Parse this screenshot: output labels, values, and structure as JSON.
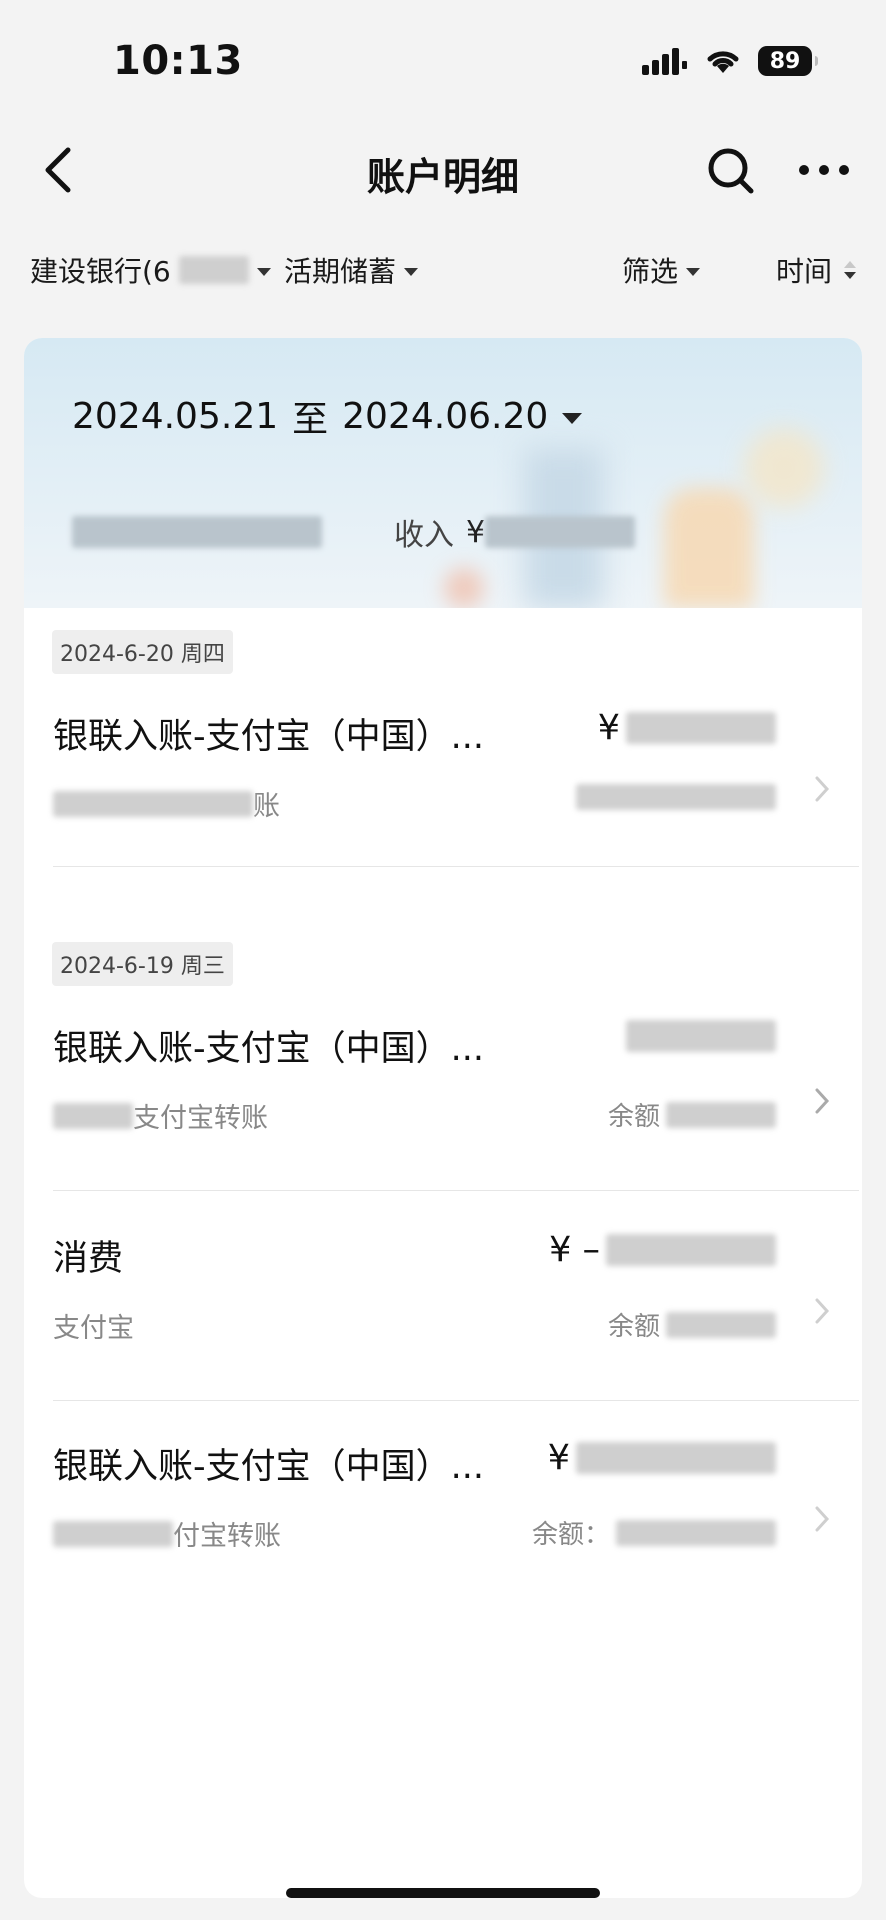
{
  "status_bar": {
    "time": "10:13",
    "battery": "89"
  },
  "nav": {
    "title": "账户明细"
  },
  "filters": {
    "account": "建设银行(6",
    "account_type": "活期储蓄",
    "filter": "筛选",
    "sort": "时间"
  },
  "summary": {
    "date_from": "2024.05.21",
    "date_sep": "至",
    "date_to": "2024.06.20",
    "income_label": "收入",
    "currency": "¥"
  },
  "transactions": [
    {
      "date": "2024-6-20 周四",
      "title": "银联入账-支付宝（中国）...",
      "amount": "¥",
      "sub": "账",
      "balance_label": "",
      "sub_prefix": ""
    },
    {
      "date": "2024-6-19 周三",
      "title": "银联入账-支付宝（中国）...",
      "amount": "",
      "sub": "支付宝转账",
      "balance_label": "余额",
      "sub_prefix": ""
    },
    {
      "date": "",
      "title": "消费",
      "amount": "¥ –",
      "sub": "支付宝",
      "balance_label": "余额",
      "sub_prefix": ""
    },
    {
      "date": "",
      "title": "银联入账-支付宝（中国）...",
      "amount": "¥",
      "sub": "付宝转账",
      "balance_label": "余额：",
      "sub_prefix": ""
    }
  ],
  "icons": {
    "back": "chevron-left-icon",
    "search": "search-icon",
    "more": "more-dots-icon",
    "chevron": "chevron-right-icon"
  },
  "colors": {
    "header_gradient_top": "#d6e9f3",
    "text_primary": "#111111",
    "text_secondary": "#888888",
    "background": "#f3f3f3"
  }
}
